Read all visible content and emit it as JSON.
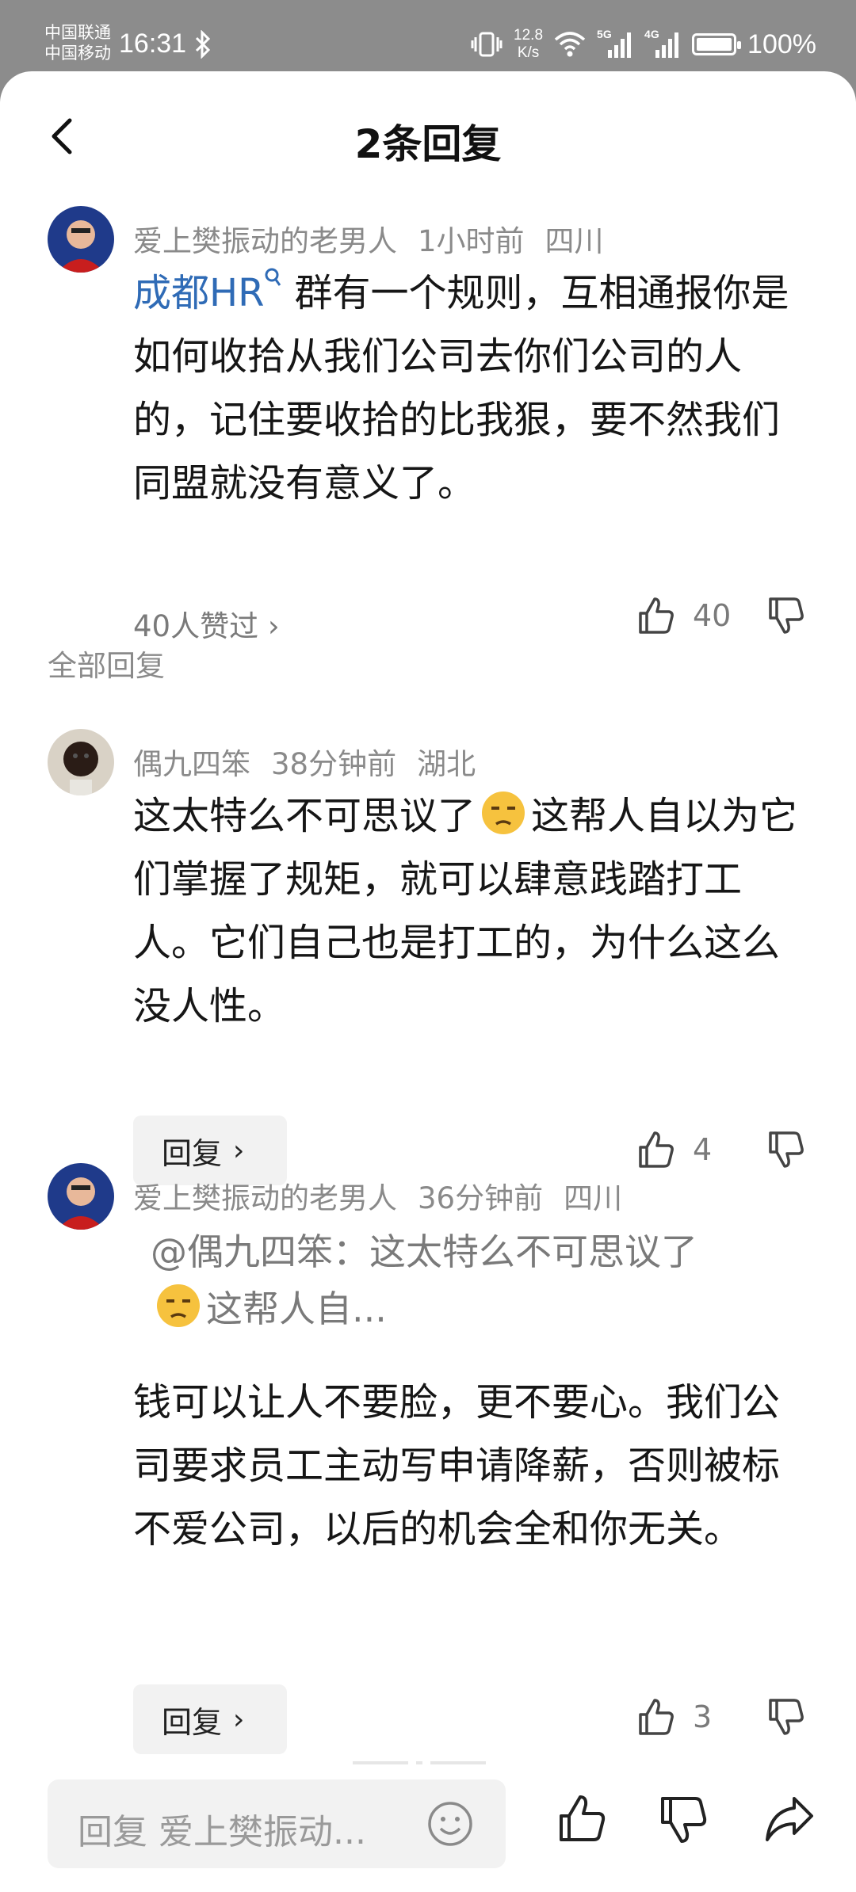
{
  "status": {
    "carrier1": "中国联通",
    "carrier2": "中国移动",
    "time": "16:31",
    "speed_value": "12.8",
    "speed_unit": "K/s",
    "signal1_label": "5G",
    "signal2_label": "4G",
    "battery": "100%"
  },
  "header": {
    "title": "2条回复"
  },
  "main_comment": {
    "author": "爱上樊振动的老男人",
    "time": "1小时前",
    "location": "四川",
    "link_text": "成都HR",
    "text": "群有一个规则，互相通报你是如何收拾从我们公司去你们公司的人的，记住要收拾的比我狠，要不然我们同盟就没有意义了。",
    "likes_link": "40人赞过",
    "like_count": "40"
  },
  "section_label": "全部回复",
  "replies": [
    {
      "author": "偶九四笨",
      "time": "38分钟前",
      "location": "湖北",
      "text_before": "这太特么不可思议了",
      "text_after": "这帮人自以为它们掌握了规矩，就可以肆意践踏打工人。它们自己也是打工的，为什么这么没人性。",
      "like_count": "4",
      "reply_label": "回复"
    },
    {
      "author": "爱上樊振动的老男人",
      "time": "36分钟前",
      "location": "四川",
      "quote_before": "@偶九四笨：这太特么不可思议了",
      "quote_after": "这帮人自...",
      "text": "钱可以让人不要脸，更不要心。我们公司要求员工主动写申请降薪，否则被标不爱公司，以后的机会全和你无关。",
      "like_count": "3",
      "reply_label": "回复"
    }
  ],
  "bottom": {
    "placeholder": "回复 爱上樊振动..."
  }
}
